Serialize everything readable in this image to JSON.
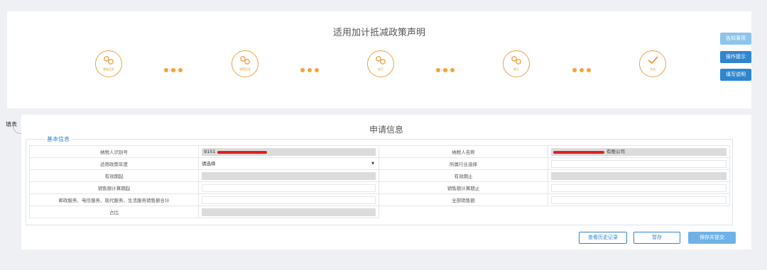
{
  "header": {
    "title": "适用加计抵减政策声明",
    "steps": [
      {
        "label": "基础信息",
        "icon": "gear-icon"
      },
      {
        "label": "政策信息",
        "icon": "gear-icon"
      },
      {
        "label": "填写",
        "icon": "gear-icon"
      },
      {
        "label": "确认",
        "icon": "gear-icon"
      },
      {
        "label": "完成",
        "icon": "check-icon"
      }
    ]
  },
  "side_buttons": {
    "notice": "告知事项",
    "tips": "操作提示",
    "guide": "填写说明"
  },
  "form": {
    "side_tag": "填表",
    "section_title": "申请信息",
    "legend": "基本信息",
    "rows": {
      "taxpayer_id_label": "纳税人识别号",
      "taxpayer_id_value": "9151",
      "taxpayer_name_label": "纳税人名称",
      "taxpayer_name_value": "有限公司",
      "policy_year_label": "适用政策年度",
      "policy_year_value": "请选择",
      "industry_label": "所属行业选择",
      "valid_start_label": "有效期起",
      "valid_end_label": "有效期止",
      "sales_start_label": "销售额计算期起",
      "sales_end_label": "销售额计算期止",
      "services_sales_label": "邮政服务、电信服务、现代服务、生活服务销售额合计",
      "total_sales_label": "全部销售额",
      "ratio_label": "占比"
    }
  },
  "actions": {
    "history": "查看历史记录",
    "save_draft": "暂存",
    "save_submit": "保存并提交"
  },
  "colors": {
    "accent_orange": "#f2a33a",
    "primary_blue": "#2e86cf",
    "redaction": "#e02020"
  }
}
